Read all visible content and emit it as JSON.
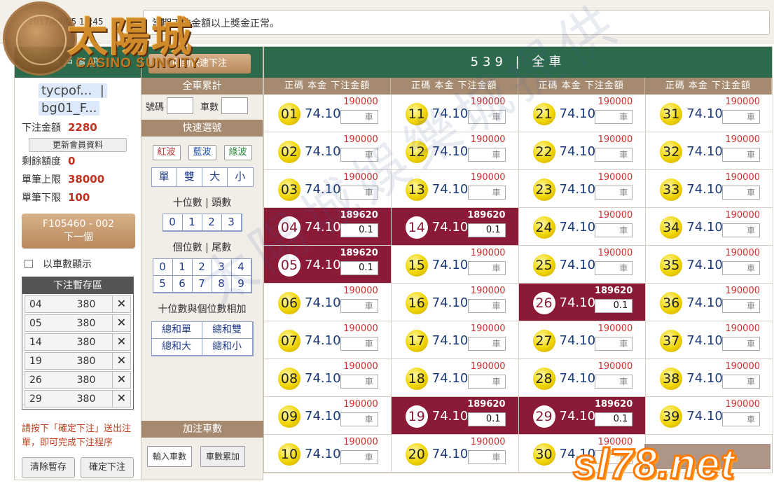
{
  "topbar": {
    "time": "2017/09/05 10:45",
    "notice": "當期下注金額以上獎金正常。"
  },
  "logo": {
    "cn": "太陽城",
    "en": "CASINO SUNCITY"
  },
  "left": {
    "header": "帳戶資訊",
    "user_line1": "tycpof...",
    "user_sep": "|",
    "user_line2": "bg01_F...",
    "rows": [
      {
        "label": "下注金額",
        "value": "2280"
      },
      {
        "label": "剩餘額度",
        "value": "0"
      },
      {
        "label": "單筆上限",
        "value": "38000"
      },
      {
        "label": "單筆下限",
        "value": "100"
      }
    ],
    "update_btn": "更新會員資料",
    "next_line1": "F105460 - 002",
    "next_line2": "下一個",
    "checkbox_label": "以車數顯示",
    "stash_title": "下注暫存區",
    "stash": [
      {
        "num": "04",
        "amt": "380"
      },
      {
        "num": "05",
        "amt": "380"
      },
      {
        "num": "14",
        "amt": "380"
      },
      {
        "num": "19",
        "amt": "380"
      },
      {
        "num": "26",
        "amt": "380"
      },
      {
        "num": "29",
        "amt": "380"
      }
    ],
    "remove_glyph": "✕",
    "hint": "請按下「確定下注」送出注單，即可完成下注程序",
    "clear_btn": "清除暫存",
    "confirm_btn": "確定下注"
  },
  "mid": {
    "top_btn": "回到快速下注",
    "head_total": "全車累計",
    "num_label": "號碼",
    "count_label": "車數",
    "quick_head": "快速選號",
    "waves": [
      "紅波",
      "藍波",
      "綠波"
    ],
    "wave_colors": [
      "#c03030",
      "#2050b0",
      "#2a8a3a"
    ],
    "parity": [
      "單",
      "雙",
      "大",
      "小"
    ],
    "tens_label": "十位數 | 頭數",
    "tens": [
      "0",
      "1",
      "2",
      "3"
    ],
    "ones_label": "個位數 | 尾數",
    "ones": [
      "0",
      "1",
      "2",
      "3",
      "4",
      "5",
      "6",
      "7",
      "8",
      "9"
    ],
    "sum_label": "十位數與個位數相加",
    "sums": [
      "總和單",
      "總和雙",
      "總和大",
      "總和小"
    ],
    "add_head": "加注車數",
    "add_btn1": "輸入車數",
    "add_btn2": "車數累加"
  },
  "main": {
    "title": "539 | 全車",
    "col_head": "正碼 本金 下注金額",
    "unit": "車",
    "cells": [
      {
        "n": "01",
        "odds": "74.10",
        "limit": "190000",
        "amt": "",
        "sel": false
      },
      {
        "n": "11",
        "odds": "74.10",
        "limit": "190000",
        "amt": "",
        "sel": false
      },
      {
        "n": "21",
        "odds": "74.10",
        "limit": "190000",
        "amt": "",
        "sel": false
      },
      {
        "n": "31",
        "odds": "74.10",
        "limit": "190000",
        "amt": "",
        "sel": false
      },
      {
        "n": "02",
        "odds": "74.10",
        "limit": "190000",
        "amt": "",
        "sel": false
      },
      {
        "n": "12",
        "odds": "74.10",
        "limit": "190000",
        "amt": "",
        "sel": false
      },
      {
        "n": "22",
        "odds": "74.10",
        "limit": "190000",
        "amt": "",
        "sel": false
      },
      {
        "n": "32",
        "odds": "74.10",
        "limit": "190000",
        "amt": "",
        "sel": false
      },
      {
        "n": "03",
        "odds": "74.10",
        "limit": "190000",
        "amt": "",
        "sel": false
      },
      {
        "n": "13",
        "odds": "74.10",
        "limit": "190000",
        "amt": "",
        "sel": false
      },
      {
        "n": "23",
        "odds": "74.10",
        "limit": "190000",
        "amt": "",
        "sel": false
      },
      {
        "n": "33",
        "odds": "74.10",
        "limit": "190000",
        "amt": "",
        "sel": false
      },
      {
        "n": "04",
        "odds": "74.10",
        "limit": "189620",
        "amt": "0.1",
        "sel": true
      },
      {
        "n": "14",
        "odds": "74.10",
        "limit": "189620",
        "amt": "0.1",
        "sel": true
      },
      {
        "n": "24",
        "odds": "74.10",
        "limit": "190000",
        "amt": "",
        "sel": false
      },
      {
        "n": "34",
        "odds": "74.10",
        "limit": "190000",
        "amt": "",
        "sel": false
      },
      {
        "n": "05",
        "odds": "74.10",
        "limit": "189620",
        "amt": "0.1",
        "sel": true
      },
      {
        "n": "15",
        "odds": "74.10",
        "limit": "190000",
        "amt": "",
        "sel": false
      },
      {
        "n": "25",
        "odds": "74.10",
        "limit": "190000",
        "amt": "",
        "sel": false
      },
      {
        "n": "35",
        "odds": "74.10",
        "limit": "190000",
        "amt": "",
        "sel": false
      },
      {
        "n": "06",
        "odds": "74.10",
        "limit": "190000",
        "amt": "",
        "sel": false
      },
      {
        "n": "16",
        "odds": "74.10",
        "limit": "190000",
        "amt": "",
        "sel": false
      },
      {
        "n": "26",
        "odds": "74.10",
        "limit": "189620",
        "amt": "0.1",
        "sel": true
      },
      {
        "n": "36",
        "odds": "74.10",
        "limit": "190000",
        "amt": "",
        "sel": false
      },
      {
        "n": "07",
        "odds": "74.10",
        "limit": "190000",
        "amt": "",
        "sel": false
      },
      {
        "n": "17",
        "odds": "74.10",
        "limit": "190000",
        "amt": "",
        "sel": false
      },
      {
        "n": "27",
        "odds": "74.10",
        "limit": "190000",
        "amt": "",
        "sel": false
      },
      {
        "n": "37",
        "odds": "74.10",
        "limit": "190000",
        "amt": "",
        "sel": false
      },
      {
        "n": "08",
        "odds": "74.10",
        "limit": "190000",
        "amt": "",
        "sel": false
      },
      {
        "n": "18",
        "odds": "74.10",
        "limit": "190000",
        "amt": "",
        "sel": false
      },
      {
        "n": "28",
        "odds": "74.10",
        "limit": "190000",
        "amt": "",
        "sel": false
      },
      {
        "n": "38",
        "odds": "74.10",
        "limit": "190000",
        "amt": "",
        "sel": false
      },
      {
        "n": "09",
        "odds": "74.10",
        "limit": "190000",
        "amt": "",
        "sel": false
      },
      {
        "n": "19",
        "odds": "74.10",
        "limit": "189620",
        "amt": "0.1",
        "sel": true
      },
      {
        "n": "29",
        "odds": "74.10",
        "limit": "189620",
        "amt": "0.1",
        "sel": true
      },
      {
        "n": "39",
        "odds": "74.10",
        "limit": "190000",
        "amt": "",
        "sel": false
      },
      {
        "n": "10",
        "odds": "74.10",
        "limit": "190000",
        "amt": "",
        "sel": false
      },
      {
        "n": "20",
        "odds": "74.10",
        "limit": "190000",
        "amt": "",
        "sel": false
      },
      {
        "n": "30",
        "odds": "74.10",
        "limit": "190000",
        "amt": "",
        "sel": false
      }
    ]
  },
  "watermarks": {
    "diagonal": "太陽城娛樂城提供",
    "site": "sl78.net"
  }
}
